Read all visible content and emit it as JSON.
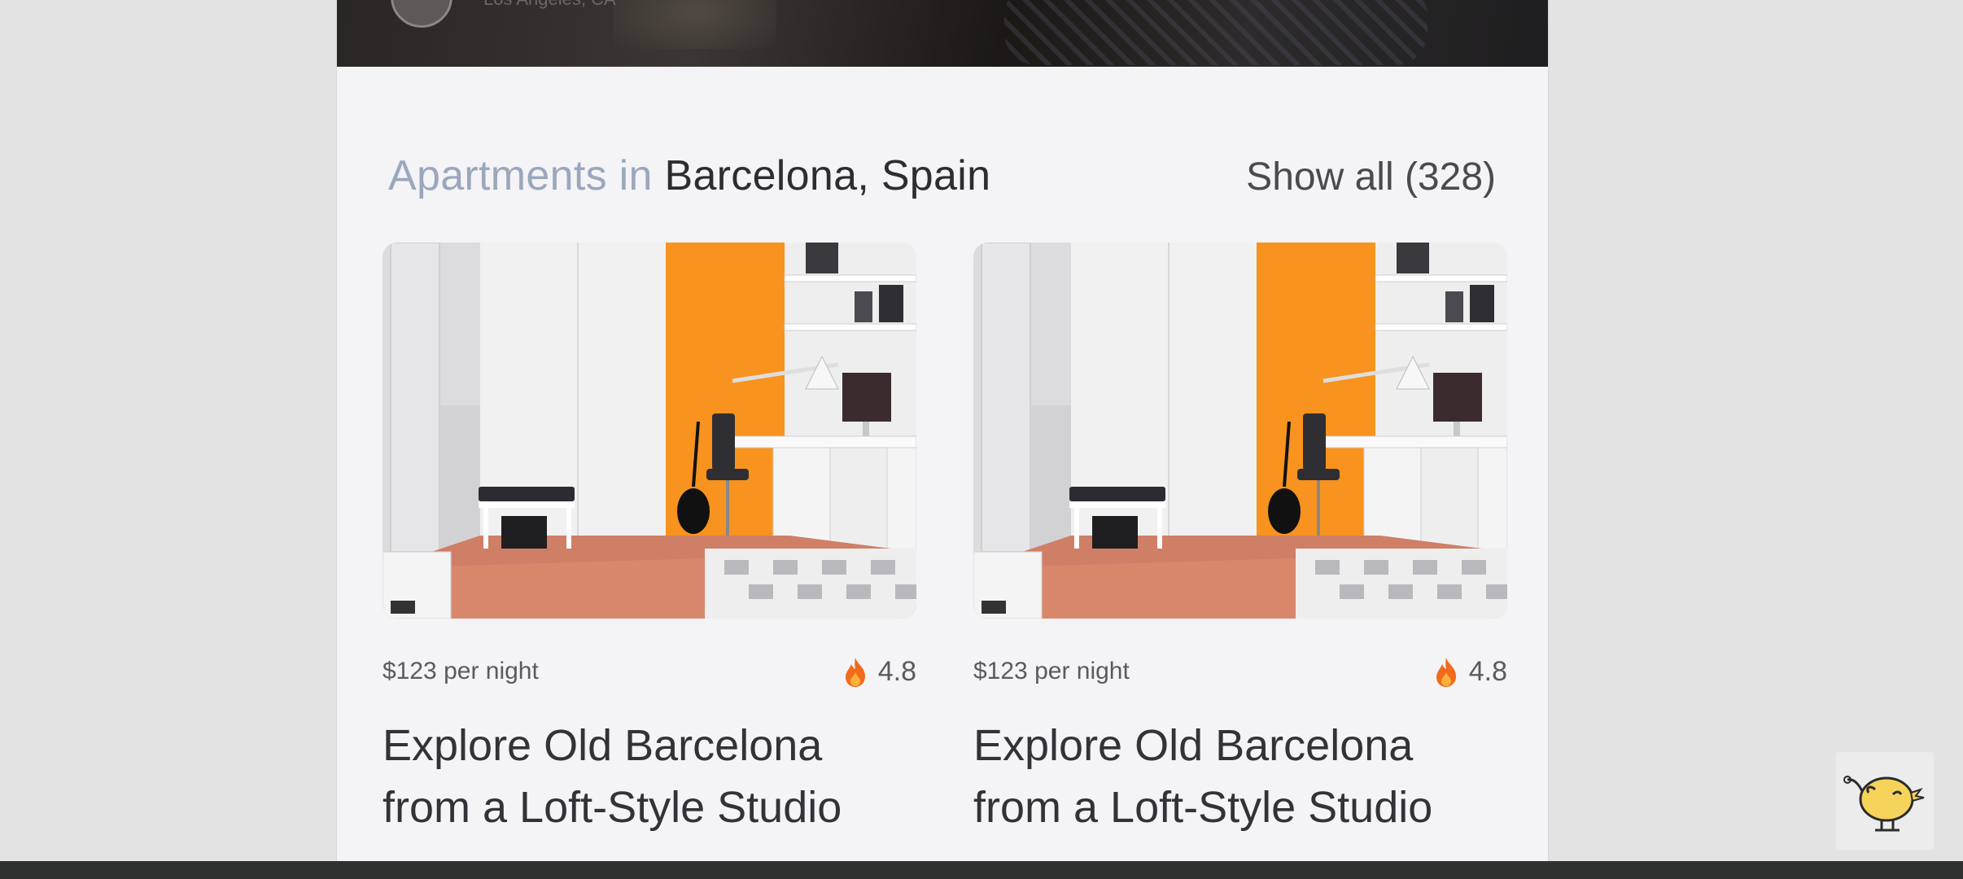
{
  "hero": {
    "location": "Los Angeles, CA"
  },
  "section": {
    "title_prefix": "Apartments in",
    "title_city": "Barcelona, Spain",
    "show_all": "Show all (328)"
  },
  "listings": [
    {
      "price": "$123 per night",
      "rating": "4.8",
      "title": "Explore Old Barcelona from a Loft-Style Studio"
    },
    {
      "price": "$123 per night",
      "rating": "4.8",
      "title": "Explore Old Barcelona from a Loft-Style Studio"
    }
  ],
  "icons": {
    "rating": "fire-icon",
    "badge": "bird-icon"
  },
  "colors": {
    "accent_orange": "#f7931e",
    "title_muted": "#9aa7bd",
    "title_strong": "#2d2c31"
  }
}
